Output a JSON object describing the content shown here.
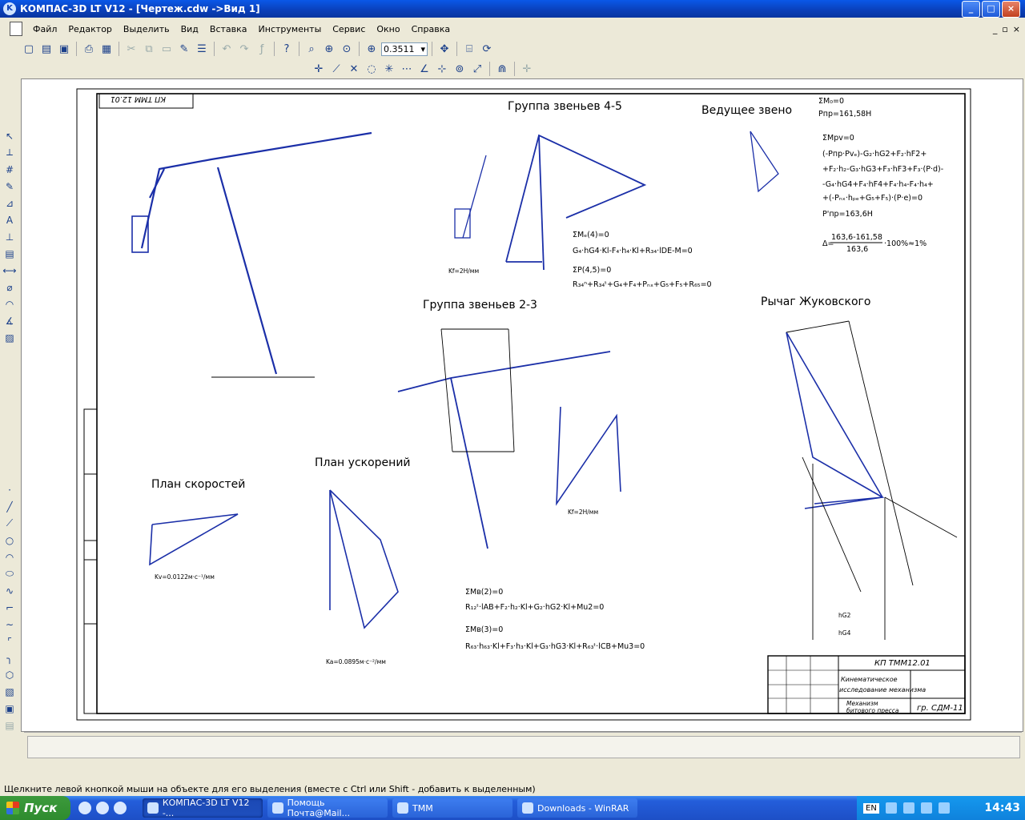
{
  "window": {
    "title": "КОМПАС-3D LT V12 - [Чертеж.cdw ->Вид 1]",
    "buttons": [
      "_",
      "□",
      "×"
    ]
  },
  "menu": [
    "Файл",
    "Редактор",
    "Выделить",
    "Вид",
    "Вставка",
    "Инструменты",
    "Сервис",
    "Окно",
    "Справка"
  ],
  "toolbar": {
    "zoom_value": "0.3511"
  },
  "drawing": {
    "stamp_mirror": "КП ТММ 12.01",
    "group_45": "Группа звеньев 4-5",
    "lead_link": "Ведущее звено",
    "group_23": "Группа звеньев 2-3",
    "zhukovsky": "Рычаг Жуковского",
    "velocity_plan": "План скоростей",
    "accel_plan": "План ускорений",
    "eq_m0": "ΣM₀=0",
    "eq_ppr1": "Pпр=161,58Н",
    "eq_mpv": "ΣMрv=0",
    "eq_long1": "(-Pпр·Pvₑ)-G₂·hG2+F₂·hF2+",
    "eq_long2": "+F₂·h₂-G₃·hG3+F₃·hF3+F₃·(P·d)-",
    "eq_long3": "-G₄·hG4+F₄·hF4+F₄·h₄-F₄·h₄+",
    "eq_long4": "+(-Pₙₓ·hₚₑ+G₅+F₅)·(P·e)=0",
    "eq_ppr2": "P'пр=163,6Н",
    "eq_delta_a": "163,6-161,58",
    "eq_delta_b": "163,6",
    "eq_delta_c": "·100%≈1%",
    "eq_me4": "ΣMₑ(4)=0",
    "eq_me4_full": "G₄·hG4·Kl-F₄·h₄·Kl+R₃₄·lDE-M=0",
    "eq_p45": "ΣP(4,5)=0",
    "eq_p45_full": "R₃₄ⁿ+R₃₄ᵗ+G₄+F₄+Pₙₓ+G₅+F₅+R₆₅=0",
    "eq_mb2": "ΣMв(2)=0",
    "eq_mb2_full": "R₁₂ᵗ·lAB+F₂·h₂·Kl+G₂·hG2·Kl+Mu2=0",
    "eq_mb3": "ΣMв(3)=0",
    "eq_mb3_full": "R₆₃·h₆₃·Kl+F₃·h₃·Kl+G₃·hG3·Kl+R₆₃ᵗ·lCB+Mu3=0",
    "kf1": "Kf=2Н/мм",
    "kf2": "Kf=2Н/мм",
    "kv": "Kv=0.0122м·с⁻¹/мм",
    "ka": "Ka=0.0895м·с⁻²/мм",
    "hg2": "hG2",
    "hg4": "hG4",
    "tb_code": "КП ТММ12.01",
    "tb_title1": "Кинематическое",
    "tb_title2": "исследование механизма",
    "tb_sub1": "Механизм",
    "tb_sub2": "битового пресса",
    "tb_group": "гр. СДМ-11"
  },
  "status": "Щелкните левой кнопкой мыши на объекте для его выделения (вместе с Ctrl или Shift - добавить к выделенным)",
  "taskbar": {
    "start": "Пуск",
    "tasks": [
      "КОМПАС-3D LT V12 -...",
      "Помощь Почта@Mail...",
      "ТММ",
      "Downloads - WinRAR"
    ],
    "lang": "EN",
    "clock": "14:43"
  }
}
